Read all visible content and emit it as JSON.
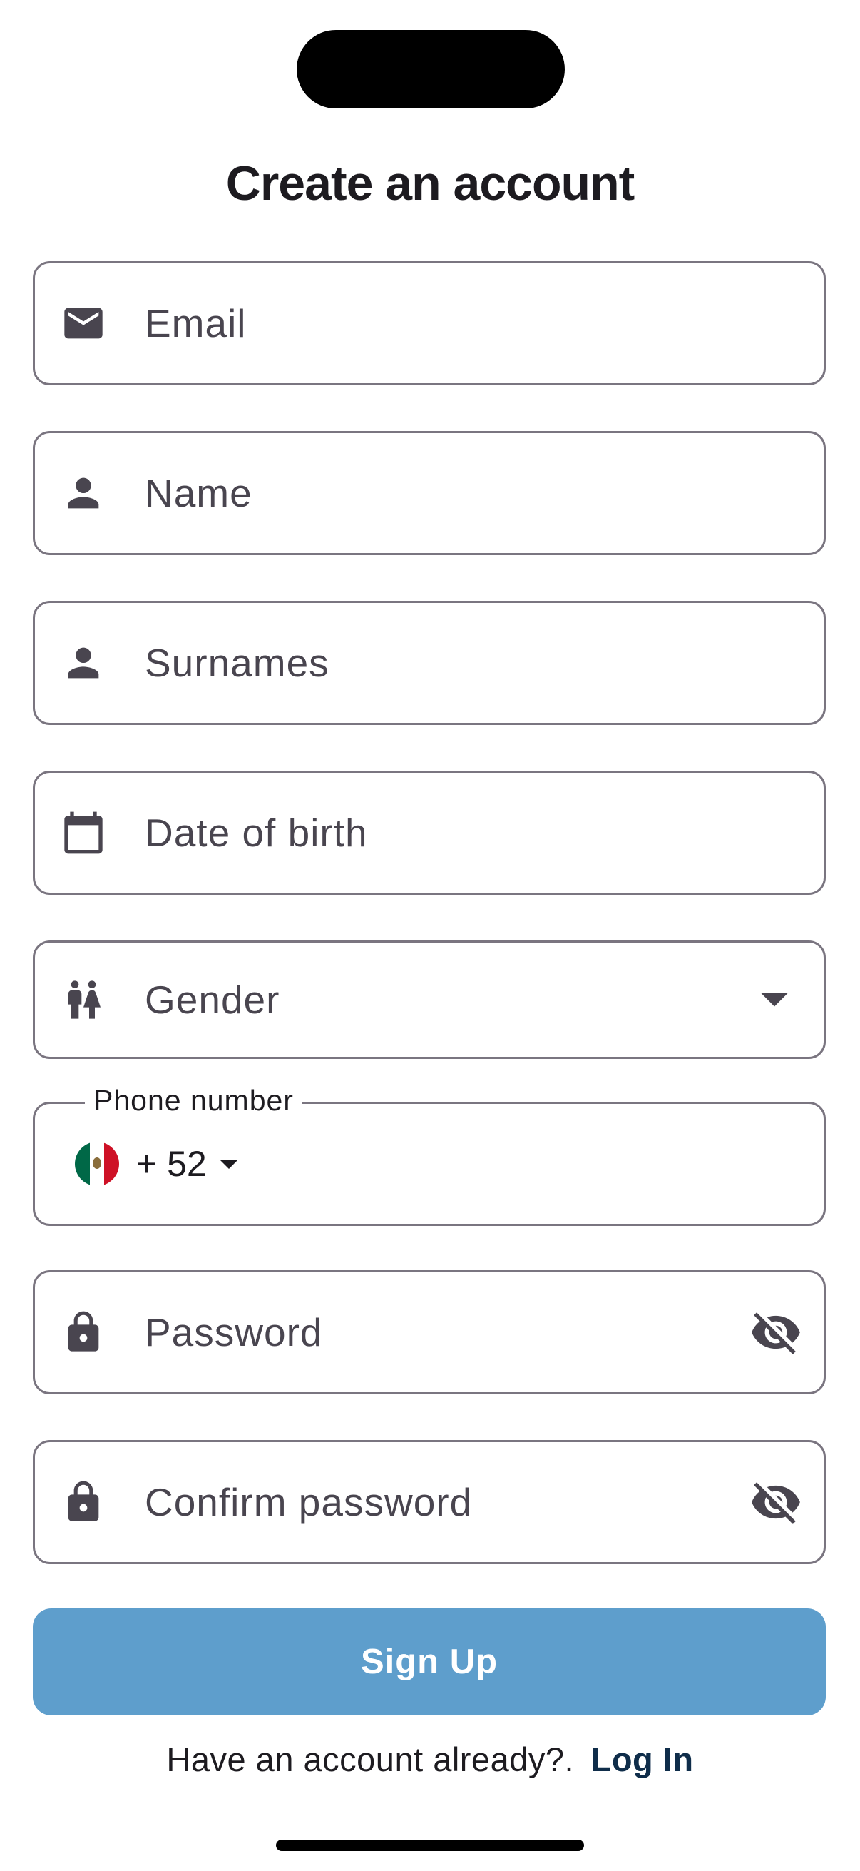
{
  "page": {
    "title": "Create an account"
  },
  "form": {
    "email": {
      "placeholder": "Email",
      "icon": "mail-icon"
    },
    "name": {
      "placeholder": "Name",
      "icon": "person-icon"
    },
    "surnames": {
      "placeholder": "Surnames",
      "icon": "person-icon"
    },
    "date_of_birth": {
      "placeholder": "Date of birth",
      "icon": "calendar-icon"
    },
    "gender": {
      "label": "Gender",
      "icon": "wc-icon"
    },
    "phone": {
      "label": "Phone number",
      "country_code": "+ 52",
      "country_flag": "mexico-flag",
      "value": ""
    },
    "password": {
      "placeholder": "Password",
      "icon": "lock-icon",
      "toggle_icon": "visibility-off-icon"
    },
    "confirm_password": {
      "placeholder": "Confirm password",
      "icon": "lock-icon",
      "toggle_icon": "visibility-off-icon"
    }
  },
  "actions": {
    "signup_label": "Sign Up",
    "login_prompt": "Have an account already?.",
    "login_link": "Log In"
  },
  "colors": {
    "accent": "#5e9ecc",
    "link": "#0f2d4a",
    "icon": "#49454f",
    "outline": "#7a7580"
  }
}
